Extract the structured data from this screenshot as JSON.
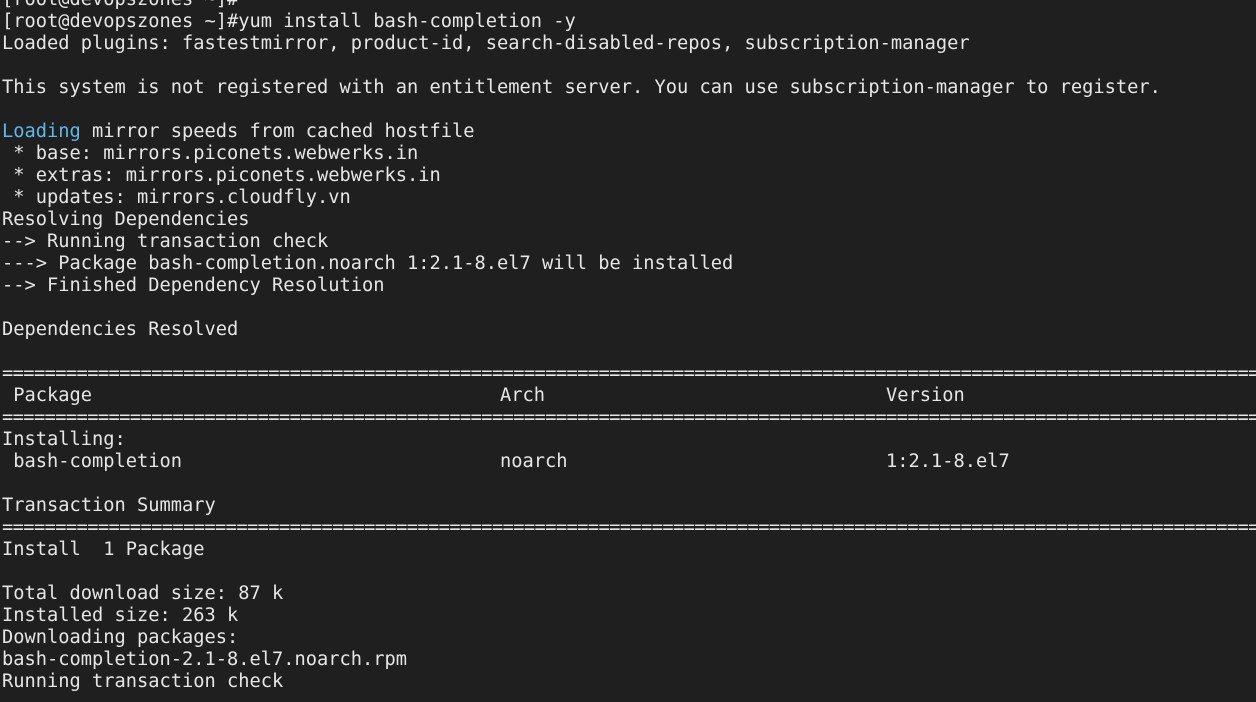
{
  "terminal": {
    "prompt_prev": "[root@devopszones ~]#",
    "command_line": "[root@devopszones ~]#yum install bash-completion -y",
    "plugins": "Loaded plugins: fastestmirror, product-id, search-disabled-repos, subscription-manager",
    "not_registered": "This system is not registered with an entitlement server. You can use subscription-manager to register.",
    "loading_word": "Loading",
    "loading_rest": " mirror speeds from cached hostfile",
    "mirror_base": " * base: mirrors.piconets.webwerks.in",
    "mirror_extras": " * extras: mirrors.piconets.webwerks.in",
    "mirror_updates": " * updates: mirrors.cloudfly.vn",
    "resolving": "Resolving Dependencies",
    "running_check": "--> Running transaction check",
    "package_install": "---> Package bash-completion.noarch 1:2.1-8.el7 will be installed",
    "finished": "--> Finished Dependency Resolution",
    "deps_resolved": "Dependencies Resolved",
    "rule": "====================================================================================================================================================",
    "table": {
      "headers": [
        " Package",
        "Arch",
        "Version"
      ],
      "section": "Installing:",
      "row": [
        " bash-completion",
        "noarch",
        "1:2.1-8.el7"
      ]
    },
    "transaction_summary": "Transaction Summary",
    "install_count": "Install  1 Package",
    "download_size": "Total download size: 87 k",
    "installed_size": "Installed size: 263 k",
    "downloading": "Downloading packages:",
    "rpm_file": "bash-completion-2.1-8.el7.noarch.rpm",
    "running_check_final": "Running transaction check"
  }
}
